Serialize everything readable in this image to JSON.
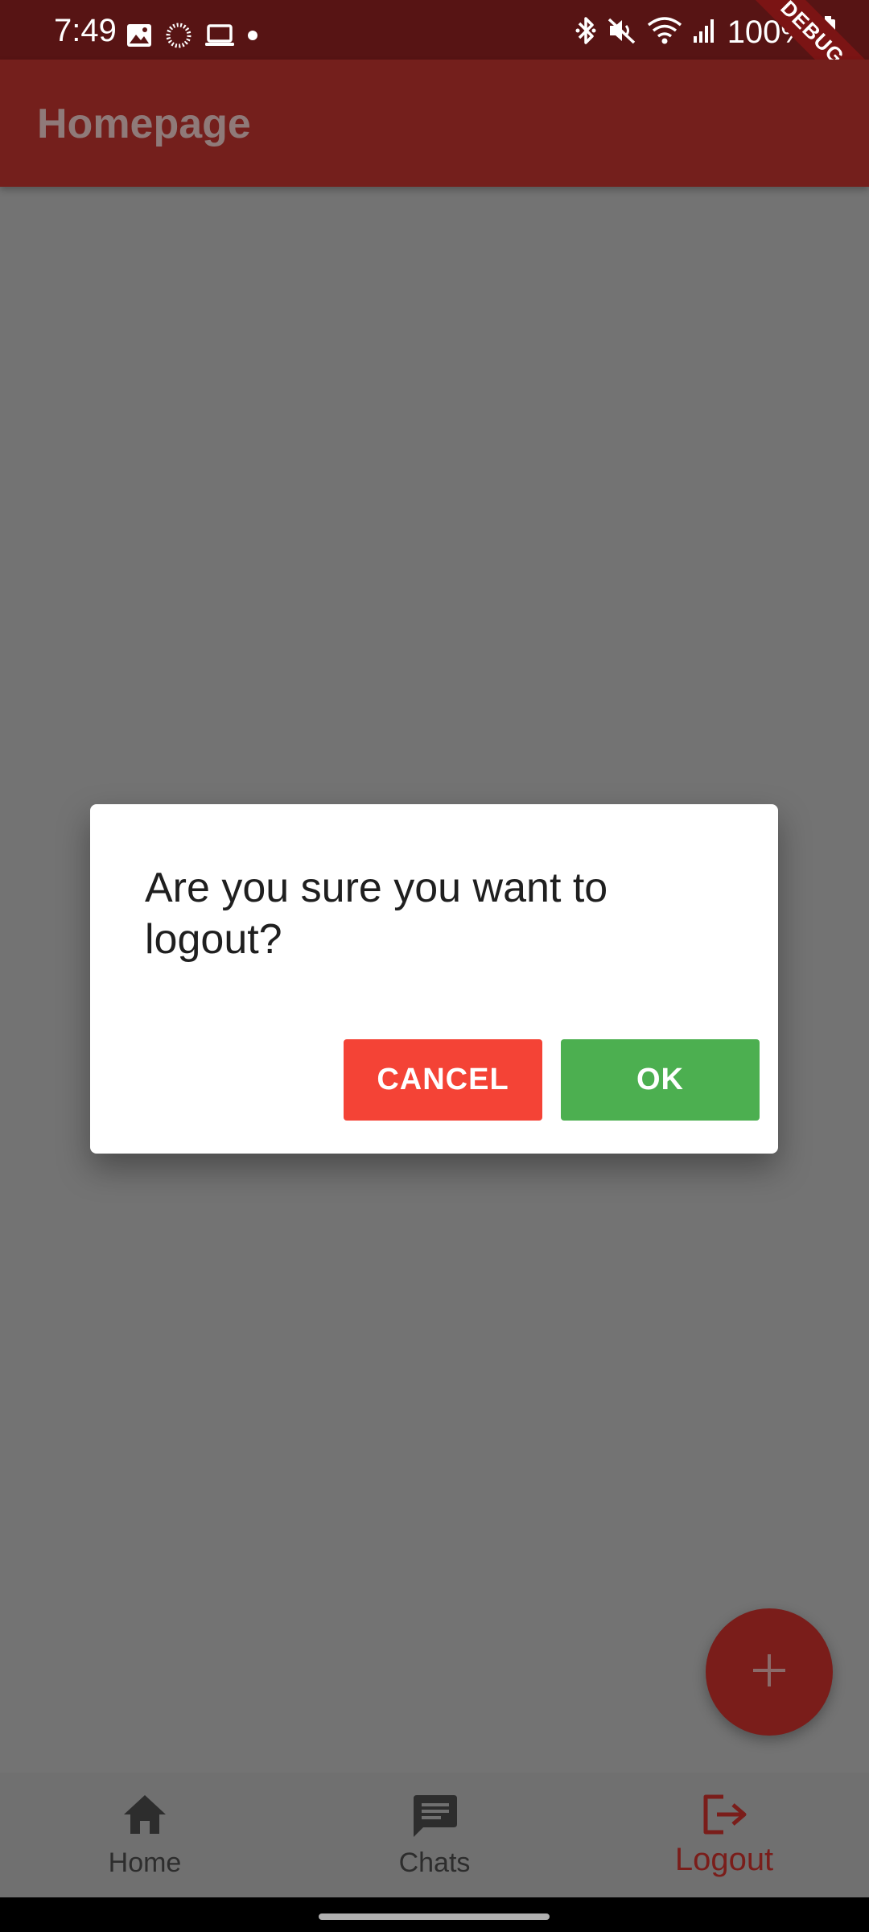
{
  "status_bar": {
    "time": "7:49",
    "battery": "100%",
    "left_icons": [
      "image-icon",
      "loading-ring-icon",
      "laptop-icon",
      "dot-icon"
    ],
    "right_icons": [
      "bluetooth-icon",
      "mute-icon",
      "wifi-icon",
      "signal-icon",
      "battery-icon"
    ]
  },
  "debug_banner": "DEBUG",
  "app_bar": {
    "title": "Homepage"
  },
  "dialog": {
    "message": "Are you sure you want to logout?",
    "cancel_label": "CANCEL",
    "ok_label": "OK"
  },
  "fab": {
    "icon": "plus-icon"
  },
  "bottom_nav": {
    "items": [
      {
        "label": "Home",
        "icon": "home-icon",
        "active": false
      },
      {
        "label": "Chats",
        "icon": "chat-icon",
        "active": false
      },
      {
        "label": "Logout",
        "icon": "logout-icon",
        "active": true
      }
    ]
  },
  "colors": {
    "status_bar_bg": "#571414",
    "app_bar_bg": "#741f1c",
    "scrim_bg": "#737373",
    "cancel_button": "#f44336",
    "ok_button": "#4caf50",
    "accent": "#7a1d1a"
  }
}
